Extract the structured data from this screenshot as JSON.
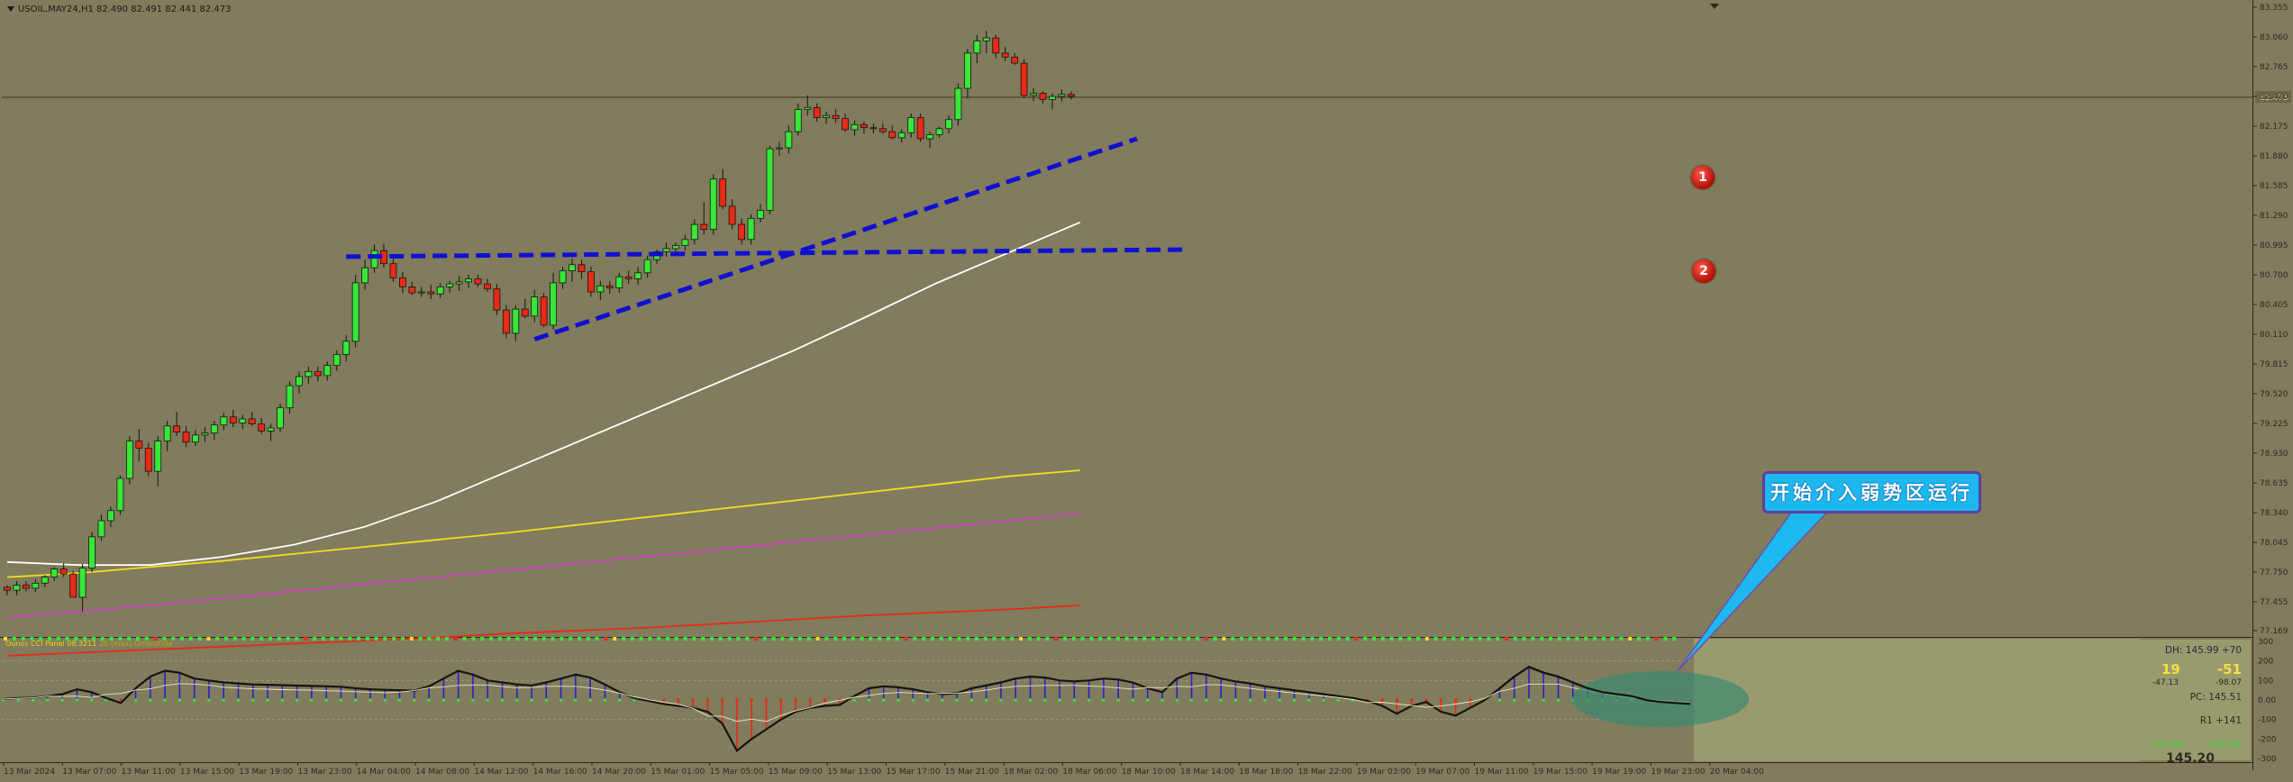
{
  "symbol_header": "USOIL,MAY24,H1  82.490 82.491 82.441 82.473",
  "current_price_label": "82.473",
  "indicator_label": "Ounos CCI Panel 08.3211",
  "indicator_sublabel": "20 (max) GmenIOde",
  "callout_text": "开始介入弱势区运行",
  "markers": [
    "1",
    "2"
  ],
  "info_box": {
    "dh": "DH: 145.99 +70",
    "big_left": "19",
    "big_right": "-51",
    "small_left": "-47.13",
    "small_right": "-98.07",
    "pc": "PC: 145.51",
    "r1": "R1  +141",
    "bottom_left": "145.68",
    "bottom_right": "145.92",
    "last": "145.20"
  },
  "colors": {
    "background": "#807c5d",
    "bull_candle": "#38e838",
    "bear_candle": "#e82a16",
    "trendline": "#1010d0",
    "ma_white": "#ffffff",
    "ma_yellow": "#f2e020",
    "ma_magenta": "#d040c0",
    "ma_red": "#e82a16",
    "callout_fill": "#1eb8f0",
    "callout_border": "#5e3fa0"
  },
  "chart_data": {
    "type": "candlestick",
    "title": "USOIL,MAY24,H1",
    "y_axis_ticks": [
      "83.355",
      "83.060",
      "82.765",
      "82.470",
      "82.175",
      "81.880",
      "81.585",
      "81.290",
      "80.995",
      "80.700",
      "80.405",
      "80.110",
      "79.815",
      "79.520",
      "79.225",
      "78.930",
      "78.635",
      "78.340",
      "78.045",
      "77.750",
      "77.455",
      "77.169"
    ],
    "ylim": [
      77.169,
      83.355
    ],
    "x_axis_ticks": [
      "13 Mar 2024",
      "13 Mar 07:00",
      "13 Mar 11:00",
      "13 Mar 15:00",
      "13 Mar 19:00",
      "13 Mar 23:00",
      "14 Mar 04:00",
      "14 Mar 08:00",
      "14 Mar 12:00",
      "14 Mar 16:00",
      "14 Mar 20:00",
      "15 Mar 01:00",
      "15 Mar 05:00",
      "15 Mar 09:00",
      "15 Mar 13:00",
      "15 Mar 17:00",
      "15 Mar 21:00",
      "18 Mar 02:00",
      "18 Mar 06:00",
      "18 Mar 10:00",
      "18 Mar 14:00",
      "18 Mar 18:00",
      "18 Mar 22:00",
      "19 Mar 03:00",
      "19 Mar 07:00",
      "19 Mar 11:00",
      "19 Mar 15:00",
      "19 Mar 19:00",
      "19 Mar 23:00",
      "20 Mar 04:00"
    ],
    "candles": [
      [
        77.6,
        77.62,
        77.52,
        77.57
      ],
      [
        77.57,
        77.66,
        77.52,
        77.62
      ],
      [
        77.62,
        77.66,
        77.56,
        77.59
      ],
      [
        77.59,
        77.68,
        77.55,
        77.64
      ],
      [
        77.64,
        77.72,
        77.6,
        77.7
      ],
      [
        77.7,
        77.8,
        77.66,
        77.78
      ],
      [
        77.78,
        77.84,
        77.7,
        77.73
      ],
      [
        77.73,
        77.76,
        77.5,
        77.5
      ],
      [
        77.5,
        77.83,
        77.36,
        77.79
      ],
      [
        77.79,
        78.15,
        77.75,
        78.1
      ],
      [
        78.1,
        78.32,
        78.06,
        78.26
      ],
      [
        78.26,
        78.4,
        78.2,
        78.36
      ],
      [
        78.36,
        78.71,
        78.32,
        78.68
      ],
      [
        78.68,
        79.1,
        78.62,
        79.05
      ],
      [
        79.05,
        79.17,
        78.85,
        78.98
      ],
      [
        78.98,
        79.03,
        78.7,
        78.75
      ],
      [
        78.75,
        79.1,
        78.6,
        79.05
      ],
      [
        79.05,
        79.25,
        78.95,
        79.2
      ],
      [
        79.2,
        79.34,
        79.1,
        79.14
      ],
      [
        79.14,
        79.2,
        78.99,
        79.04
      ],
      [
        79.04,
        79.16,
        79.0,
        79.11
      ],
      [
        79.11,
        79.19,
        79.04,
        79.13
      ],
      [
        79.13,
        79.25,
        79.06,
        79.21
      ],
      [
        79.21,
        79.33,
        79.16,
        79.29
      ],
      [
        79.29,
        79.36,
        79.19,
        79.23
      ],
      [
        79.23,
        79.31,
        79.17,
        79.27
      ],
      [
        79.27,
        79.34,
        79.2,
        79.22
      ],
      [
        79.22,
        79.28,
        79.12,
        79.15
      ],
      [
        79.15,
        79.22,
        79.05,
        79.18
      ],
      [
        79.18,
        79.42,
        79.14,
        79.38
      ],
      [
        79.38,
        79.64,
        79.32,
        79.6
      ],
      [
        79.6,
        79.74,
        79.52,
        79.69
      ],
      [
        79.69,
        79.79,
        79.62,
        79.74
      ],
      [
        79.74,
        79.79,
        79.64,
        79.7
      ],
      [
        79.7,
        79.84,
        79.65,
        79.8
      ],
      [
        79.8,
        79.95,
        79.75,
        79.91
      ],
      [
        79.91,
        80.1,
        79.84,
        80.04
      ],
      [
        80.04,
        80.7,
        79.98,
        80.62
      ],
      [
        80.62,
        80.85,
        80.55,
        80.77
      ],
      [
        80.77,
        81.0,
        80.72,
        80.94
      ],
      [
        80.94,
        81.01,
        80.77,
        80.81
      ],
      [
        80.81,
        80.87,
        80.63,
        80.67
      ],
      [
        80.67,
        80.73,
        80.52,
        80.58
      ],
      [
        80.58,
        80.63,
        80.5,
        80.52
      ],
      [
        80.52,
        80.58,
        80.48,
        80.53
      ],
      [
        80.53,
        80.6,
        80.46,
        80.51
      ],
      [
        80.51,
        80.62,
        80.47,
        80.58
      ],
      [
        80.58,
        80.64,
        80.52,
        80.61
      ],
      [
        80.61,
        80.69,
        80.54,
        80.63
      ],
      [
        80.63,
        80.7,
        80.57,
        80.66
      ],
      [
        80.66,
        80.7,
        80.58,
        80.61
      ],
      [
        80.61,
        80.66,
        80.53,
        80.56
      ],
      [
        80.56,
        80.61,
        80.3,
        80.35
      ],
      [
        80.35,
        80.4,
        80.07,
        80.12
      ],
      [
        80.12,
        80.4,
        80.04,
        80.36
      ],
      [
        80.36,
        80.46,
        80.27,
        80.29
      ],
      [
        80.29,
        80.55,
        80.23,
        80.48
      ],
      [
        80.48,
        80.52,
        80.18,
        80.2
      ],
      [
        80.2,
        80.72,
        80.16,
        80.62
      ],
      [
        80.62,
        80.78,
        80.56,
        80.74
      ],
      [
        80.74,
        80.86,
        80.63,
        80.8
      ],
      [
        80.8,
        80.85,
        80.66,
        80.73
      ],
      [
        80.73,
        80.78,
        80.48,
        80.53
      ],
      [
        80.53,
        80.64,
        80.45,
        80.59
      ],
      [
        80.59,
        80.64,
        80.51,
        80.57
      ],
      [
        80.57,
        80.72,
        80.52,
        80.68
      ],
      [
        80.68,
        80.74,
        80.61,
        80.66
      ],
      [
        80.66,
        80.78,
        80.6,
        80.72
      ],
      [
        80.72,
        80.89,
        80.67,
        80.85
      ],
      [
        80.85,
        80.95,
        80.81,
        80.93
      ],
      [
        80.93,
        81.02,
        80.88,
        80.96
      ],
      [
        80.96,
        81.02,
        80.92,
        80.99
      ],
      [
        80.99,
        81.1,
        80.94,
        81.05
      ],
      [
        81.05,
        81.25,
        81.0,
        81.2
      ],
      [
        81.2,
        81.42,
        81.1,
        81.15
      ],
      [
        81.15,
        81.7,
        81.1,
        81.65
      ],
      [
        81.65,
        81.75,
        81.35,
        81.38
      ],
      [
        81.38,
        81.45,
        81.15,
        81.2
      ],
      [
        81.2,
        81.26,
        81.0,
        81.05
      ],
      [
        81.05,
        81.3,
        81.0,
        81.26
      ],
      [
        81.26,
        81.4,
        81.22,
        81.34
      ],
      [
        81.34,
        81.98,
        81.3,
        81.95
      ],
      [
        81.95,
        82.02,
        81.88,
        81.96
      ],
      [
        81.96,
        82.18,
        81.9,
        82.12
      ],
      [
        82.12,
        82.4,
        82.08,
        82.34
      ],
      [
        82.34,
        82.48,
        82.28,
        82.36
      ],
      [
        82.36,
        82.4,
        82.22,
        82.26
      ],
      [
        82.26,
        82.32,
        82.2,
        82.28
      ],
      [
        82.28,
        82.34,
        82.21,
        82.25
      ],
      [
        82.25,
        82.3,
        82.12,
        82.14
      ],
      [
        82.14,
        82.23,
        82.08,
        82.19
      ],
      [
        82.19,
        82.22,
        82.1,
        82.16
      ],
      [
        82.16,
        82.2,
        82.1,
        82.15
      ],
      [
        82.15,
        82.2,
        82.1,
        82.12
      ],
      [
        82.12,
        82.18,
        82.04,
        82.06
      ],
      [
        82.06,
        82.14,
        82.01,
        82.11
      ],
      [
        82.11,
        82.3,
        82.06,
        82.26
      ],
      [
        82.26,
        82.3,
        82.02,
        82.05
      ],
      [
        82.05,
        82.12,
        81.96,
        82.09
      ],
      [
        82.09,
        82.17,
        82.06,
        82.15
      ],
      [
        82.15,
        82.28,
        82.1,
        82.24
      ],
      [
        82.24,
        82.6,
        82.18,
        82.55
      ],
      [
        82.55,
        82.94,
        82.45,
        82.9
      ],
      [
        82.9,
        83.08,
        82.8,
        83.02
      ],
      [
        83.02,
        83.12,
        82.9,
        83.05
      ],
      [
        83.05,
        83.08,
        82.85,
        82.9
      ],
      [
        82.9,
        82.96,
        82.82,
        82.86
      ],
      [
        82.86,
        82.9,
        82.78,
        82.8
      ],
      [
        82.8,
        82.84,
        82.45,
        82.48
      ],
      [
        82.48,
        82.55,
        82.42,
        82.5
      ],
      [
        82.5,
        82.52,
        82.4,
        82.44
      ],
      [
        82.44,
        82.5,
        82.34,
        82.47
      ],
      [
        82.47,
        82.54,
        82.42,
        82.49
      ],
      [
        82.49,
        82.52,
        82.44,
        82.47
      ]
    ],
    "moving_averages": [
      {
        "color": "white",
        "values": [
          77.85,
          77.82,
          77.82,
          77.9,
          78.02,
          78.2,
          78.45,
          78.75,
          79.05,
          79.35,
          79.65,
          79.95,
          80.28,
          80.62,
          80.92,
          81.22
        ]
      },
      {
        "color": "yellow",
        "values": [
          77.7,
          77.74,
          77.8,
          77.86,
          77.93,
          78.0,
          78.07,
          78.14,
          78.22,
          78.3,
          78.38,
          78.46,
          78.54,
          78.62,
          78.7,
          78.76
        ]
      },
      {
        "color": "magenta",
        "values": [
          77.3,
          77.36,
          77.42,
          77.49,
          77.56,
          77.63,
          77.7,
          77.77,
          77.84,
          77.91,
          77.98,
          78.05,
          78.12,
          78.19,
          78.26,
          78.33
        ]
      },
      {
        "color": "red",
        "values": [
          76.92,
          76.95,
          76.98,
          77.01,
          77.04,
          77.07,
          77.1,
          77.14,
          77.17,
          77.2,
          77.24,
          77.28,
          77.32,
          77.35,
          77.38,
          77.42
        ]
      }
    ],
    "trendlines": [
      {
        "name": "1",
        "from": {
          "bar": 56,
          "price": 80.06
        },
        "to": {
          "bar": 120,
          "price": 82.05
        }
      },
      {
        "name": "2",
        "from": {
          "bar": 36,
          "price": 80.88
        },
        "to": {
          "bar": 125,
          "price": 80.95
        }
      }
    ],
    "oscillator": {
      "ylim": [
        -300,
        300
      ],
      "values": [
        5,
        10,
        12,
        20,
        30,
        55,
        40,
        10,
        -15,
        60,
        120,
        150,
        140,
        110,
        100,
        90,
        85,
        80,
        78,
        76,
        74,
        72,
        70,
        68,
        60,
        55,
        52,
        50,
        48,
        70,
        110,
        150,
        130,
        100,
        90,
        80,
        75,
        90,
        110,
        130,
        115,
        80,
        40,
        10,
        -5,
        -20,
        -30,
        -40,
        -60,
        -120,
        -260,
        -200,
        -150,
        -100,
        -60,
        -40,
        -30,
        -25,
        20,
        60,
        70,
        65,
        55,
        40,
        30,
        35,
        60,
        75,
        90,
        110,
        120,
        115,
        100,
        95,
        100,
        110,
        105,
        90,
        60,
        40,
        110,
        140,
        130,
        110,
        95,
        85,
        70,
        60,
        50,
        40,
        30,
        20,
        10,
        -5,
        -30,
        -70,
        -30,
        -10,
        -60,
        -80,
        -40,
        0,
        60,
        120,
        170,
        140,
        120,
        90,
        60,
        40,
        30,
        20,
        0,
        -10,
        -15,
        -20
      ]
    }
  }
}
